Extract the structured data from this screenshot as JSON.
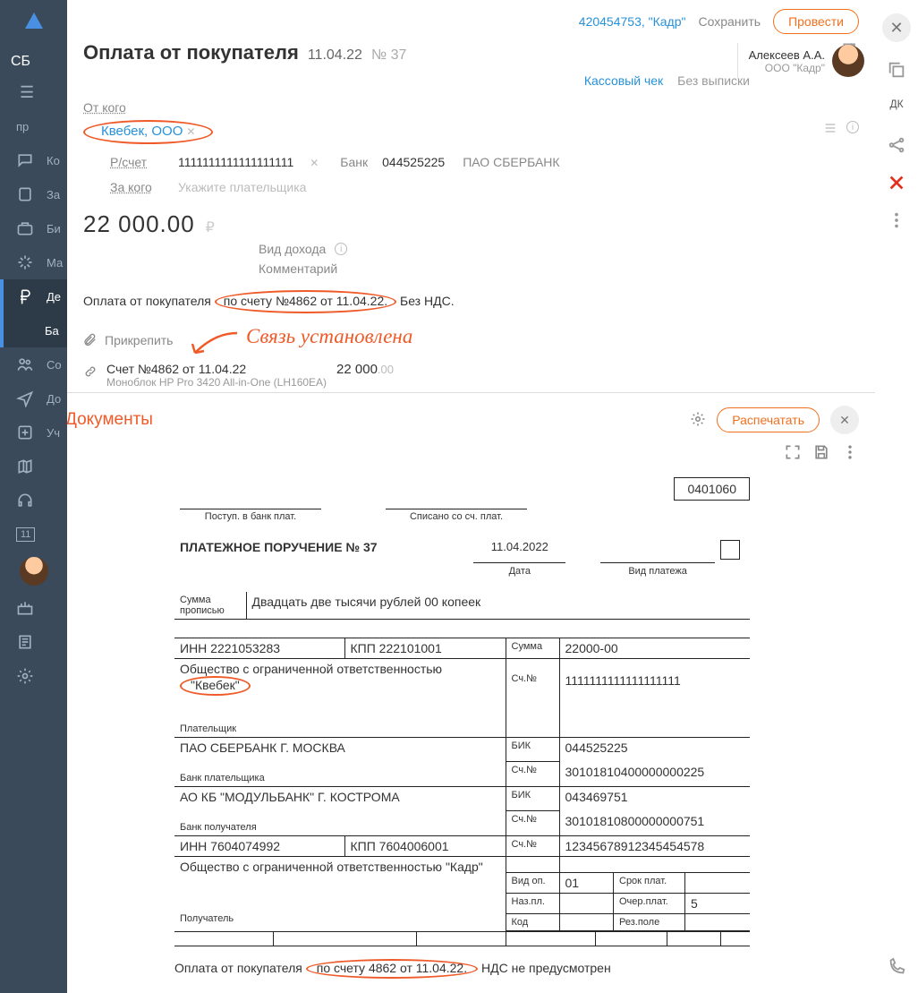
{
  "brand": "СБ",
  "sidebar": {
    "items": [
      {
        "label": "пр"
      },
      {
        "label": "Ко"
      },
      {
        "label": "За"
      },
      {
        "label": "Би"
      },
      {
        "label": "Ма"
      },
      {
        "label": "Де"
      },
      {
        "label": "Ба"
      },
      {
        "label": "Со"
      },
      {
        "label": "До"
      },
      {
        "label": "Уч"
      }
    ],
    "calendar_badge": "11"
  },
  "header": {
    "doc_id": "420454753, \"Кадр\"",
    "save": "Сохранить",
    "submit": "Провести"
  },
  "title": {
    "main": "Оплата от покупателя",
    "date": "11.04.22",
    "num_prefix": "№",
    "num": "37"
  },
  "user": {
    "name": "Алексеев А.А.",
    "org": "ООО \"Кадр\""
  },
  "toolbar": {
    "check": "Кассовый чек",
    "no_statement": "Без выписки"
  },
  "form": {
    "from_label": "От кого",
    "from_value": "Квебек, ООО",
    "acct_label": "Р/счет",
    "acct_value": "1111111111111111111",
    "bank_label": "Банк",
    "bank_bic": "044525225",
    "bank_name": "ПАО СБЕРБАНК",
    "for_label": "За кого",
    "for_placeholder": "Укажите плательщика",
    "amount": "22 000.00",
    "currency": "₽",
    "income_label": "Вид дохода",
    "comment_label": "Комментарий",
    "description_pre": "Оплата от покупателя ",
    "description_oval": "по счету №4862 от 11.04.22.",
    "description_post": " Без НДС.",
    "attach": "Прикрепить",
    "linked": {
      "title": "Счет №4862 от 11.04.22",
      "sub": "Моноблок HP Pro 3420 All-in-One (LH160EA)",
      "amount_int": "22 000",
      "amount_cents": ".00"
    }
  },
  "annotation": "Связь установлена",
  "docs": {
    "title": "Документы",
    "print": "Распечатать"
  },
  "po": {
    "code": "0401060",
    "bank_in": "Поступ. в банк плат.",
    "bank_out": "Списано со сч. плат.",
    "heading": "ПЛАТЕЖНОЕ ПОРУЧЕНИЕ № 37",
    "date": "11.04.2022",
    "date_label": "Дата",
    "payment_type_label": "Вид платежа",
    "sum_words_label": "Сумма прописью",
    "sum_words": "Двадцать две тысячи рублей 00 копеек",
    "inn1_label": "ИНН 2221053283",
    "kpp1_label": "КПП 222101001",
    "payer_name": "Общество с ограниченной ответственностью \"Квебек\"",
    "payer_name_pre": "Общество с ограниченной ответственностью ",
    "payer_name_oval": "\"Квебек\"",
    "payer_label": "Плательщик",
    "payer_bank": "ПАО СБЕРБАНК Г. МОСКВА",
    "payer_bank_label": "Банк плательщика",
    "recv_bank": "АО КБ \"МОДУЛЬБАНК\" Г. КОСТРОМА",
    "recv_bank_label": "Банк получателя",
    "inn2_label": "ИНН 7604074992",
    "kpp2_label": "КПП 7604006001",
    "recv_name": "Общество с ограниченной ответственностью \"Кадр\"",
    "recv_label": "Получатель",
    "summa_label": "Сумма",
    "summa": "22000-00",
    "sch_label": "Сч.№",
    "acct": "1111111111111111111",
    "bic_label": "БИК",
    "bic1": "044525225",
    "corr1": "30101810400000000225",
    "bic2": "043469751",
    "corr2": "30101810800000000751",
    "recv_acct": "12345678912345454578",
    "vid_op_label": "Вид оп.",
    "vid_op": "01",
    "srok_label": "Срок плат.",
    "naz_pl_label": "Наз.пл.",
    "ocher_label": "Очер.плат.",
    "ocher": "5",
    "kod_label": "Код",
    "res_label": "Рез.поле",
    "purpose_pre": "Оплата от покупателя ",
    "purpose_oval": "по счету 4862 от 11.04.22.",
    "purpose_post": " НДС не предусмотрен"
  },
  "rail": {
    "dk": "ДК"
  }
}
